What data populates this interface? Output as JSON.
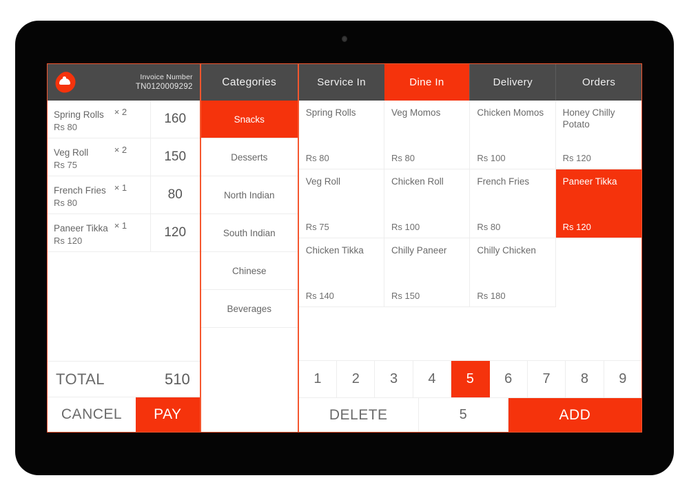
{
  "device": {
    "type": "tablet",
    "camera": "camera-dot"
  },
  "colors": {
    "accent": "#F5330C",
    "header_dark": "#4A4A4A",
    "border": "#EDEDED",
    "screen_border": "#F5562E",
    "text_muted": "#6A6A6A"
  },
  "order_panel": {
    "logo_name": "restaurant-logo",
    "invoice_label": "Invoice Number",
    "invoice_number": "TN0120009292",
    "items": [
      {
        "name": "Spring Rolls",
        "rate": "Rs 80",
        "qty": "× 2",
        "amount": "160"
      },
      {
        "name": "Veg Roll",
        "rate": "Rs 75",
        "qty": "× 2",
        "amount": "150"
      },
      {
        "name": "French Fries",
        "rate": "Rs 80",
        "qty": "× 1",
        "amount": "80"
      },
      {
        "name": "Paneer Tikka",
        "rate": "Rs 120",
        "qty": "× 1",
        "amount": "120"
      }
    ],
    "total_label": "TOTAL",
    "total_value": "510",
    "cancel_label": "CANCEL",
    "pay_label": "PAY"
  },
  "categories": {
    "header": "Categories",
    "items": [
      {
        "label": "Snacks",
        "active": true
      },
      {
        "label": "Desserts",
        "active": false
      },
      {
        "label": "North Indian",
        "active": false
      },
      {
        "label": "South Indian",
        "active": false
      },
      {
        "label": "Chinese",
        "active": false
      },
      {
        "label": "Beverages",
        "active": false
      }
    ]
  },
  "service_tabs": [
    {
      "label": "Service In",
      "active": false
    },
    {
      "label": "Dine In",
      "active": true
    },
    {
      "label": "Delivery",
      "active": false
    },
    {
      "label": "Orders",
      "active": false
    }
  ],
  "menu_grid": {
    "items": [
      {
        "name": "Spring Rolls",
        "price": "Rs 80",
        "selected": false
      },
      {
        "name": "Veg Momos",
        "price": "Rs 80",
        "selected": false
      },
      {
        "name": "Chicken Momos",
        "price": "Rs 100",
        "selected": false
      },
      {
        "name": "Honey Chilly Potato",
        "price": "Rs 120",
        "selected": false
      },
      {
        "name": "Veg Roll",
        "price": "Rs 75",
        "selected": false
      },
      {
        "name": "Chicken Roll",
        "price": "Rs 100",
        "selected": false
      },
      {
        "name": "French Fries",
        "price": "Rs 80",
        "selected": false
      },
      {
        "name": "Paneer Tikka",
        "price": "Rs 120",
        "selected": true
      },
      {
        "name": "Chicken Tikka",
        "price": "Rs 140",
        "selected": false
      },
      {
        "name": "Chilly Paneer",
        "price": "Rs 150",
        "selected": false
      },
      {
        "name": "Chilly Chicken",
        "price": "Rs 180",
        "selected": false
      },
      {
        "name": "",
        "price": "",
        "selected": false
      }
    ]
  },
  "keypad": {
    "keys": [
      {
        "label": "1",
        "active": false
      },
      {
        "label": "2",
        "active": false
      },
      {
        "label": "3",
        "active": false
      },
      {
        "label": "4",
        "active": false
      },
      {
        "label": "5",
        "active": true
      },
      {
        "label": "6",
        "active": false
      },
      {
        "label": "7",
        "active": false
      },
      {
        "label": "8",
        "active": false
      },
      {
        "label": "9",
        "active": false
      }
    ],
    "delete_label": "DELETE",
    "quantity_value": "5",
    "add_label": "ADD"
  }
}
